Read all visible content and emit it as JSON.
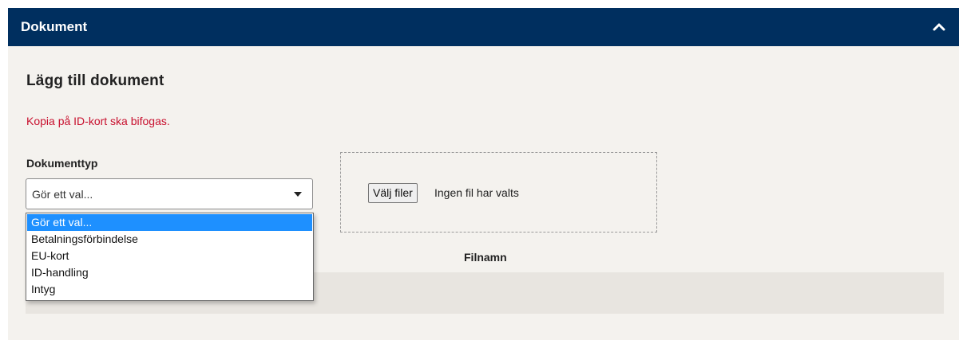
{
  "header": {
    "title": "Dokument",
    "collapse_icon": "chevron-up-icon"
  },
  "section": {
    "title": "Lägg till dokument",
    "warning": "Kopia på ID-kort ska bifogas."
  },
  "document_type": {
    "label": "Dokumenttyp",
    "selected": "Gör ett val...",
    "options": [
      "Gör ett val...",
      "Betalningsförbindelse",
      "EU-kort",
      "ID-handling",
      "Intyg"
    ]
  },
  "file_upload": {
    "button_label": "Välj filer",
    "status": "Ingen fil har valts"
  },
  "table": {
    "columns": [
      "Filnamn"
    ]
  },
  "colors": {
    "header_bg": "#002f5f",
    "panel_bg": "#f4f2ee",
    "warning": "#c8102e",
    "selected_option": "#1e90ff"
  }
}
